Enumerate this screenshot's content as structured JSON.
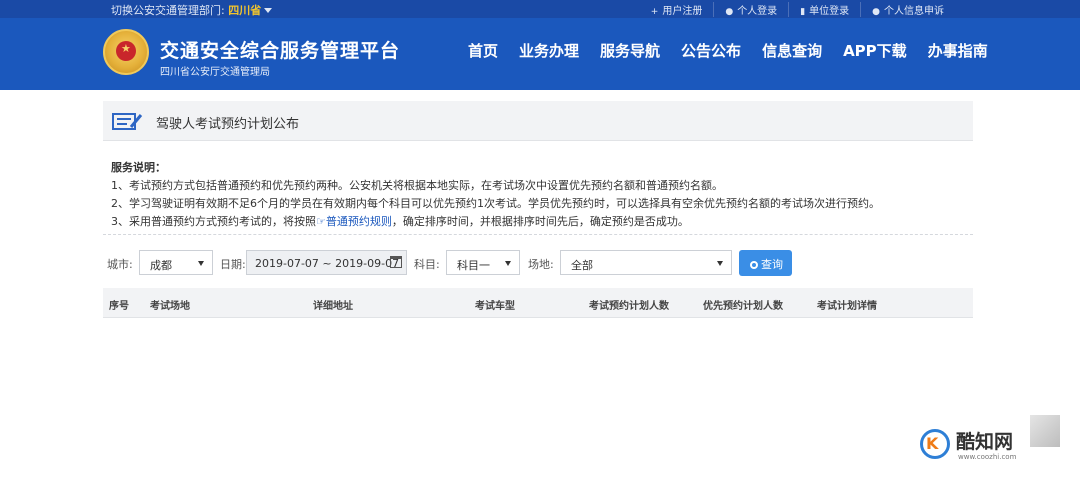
{
  "topbar": {
    "dept_label": "切换公安交通管理部门:",
    "dept_value": "四川省",
    "links": [
      {
        "icon": "+",
        "label": "用户注册"
      },
      {
        "icon": "user-icon",
        "label": "个人登录"
      },
      {
        "icon": "building-icon",
        "label": "单位登录"
      },
      {
        "icon": "user-icon",
        "label": "个人信息申诉"
      }
    ]
  },
  "header": {
    "title": "交通安全综合服务管理平台",
    "subtitle": "四川省公安厅交通管理局",
    "nav": [
      "首页",
      "业务办理",
      "服务导航",
      "公告公布",
      "信息查询",
      "APP下载",
      "办事指南"
    ]
  },
  "panel": {
    "title": "驾驶人考试预约计划公布"
  },
  "notes": {
    "heading": "服务说明：",
    "line1": "1、考试预约方式包括普通预约和优先预约两种。公安机关将根据本地实际，在考试场次中设置优先预约名额和普通预约名额。",
    "line2": "2、学习驾驶证明有效期不足6个月的学员在有效期内每个科目可以优先预约1次考试。学员优先预约时，可以选择具有空余优先预约名额的考试场次进行预约。",
    "line3_pre": "3、采用普通预约方式预约考试的，将按照",
    "line3_link": "☞普通预约规则",
    "line3_post": "，确定排序时间，并根据排序时间先后，确定预约是否成功。"
  },
  "filters": {
    "city_label": "城市:",
    "city_value": "成都",
    "date_label": "日期:",
    "date_value": "2019-07-07 ~ 2019-09-07",
    "subject_label": "科目:",
    "subject_value": "科目一",
    "site_label": "场地:",
    "site_value": "全部",
    "query_button": "查询"
  },
  "table": {
    "headers": [
      "序号",
      "考试场地",
      "详细地址",
      "考试车型",
      "考试预约计划人数",
      "优先预约计划人数",
      "考试计划详情"
    ]
  },
  "watermark": {
    "logo_glyph": "K",
    "name": "酷知网",
    "url": "www.coozhi.com"
  }
}
